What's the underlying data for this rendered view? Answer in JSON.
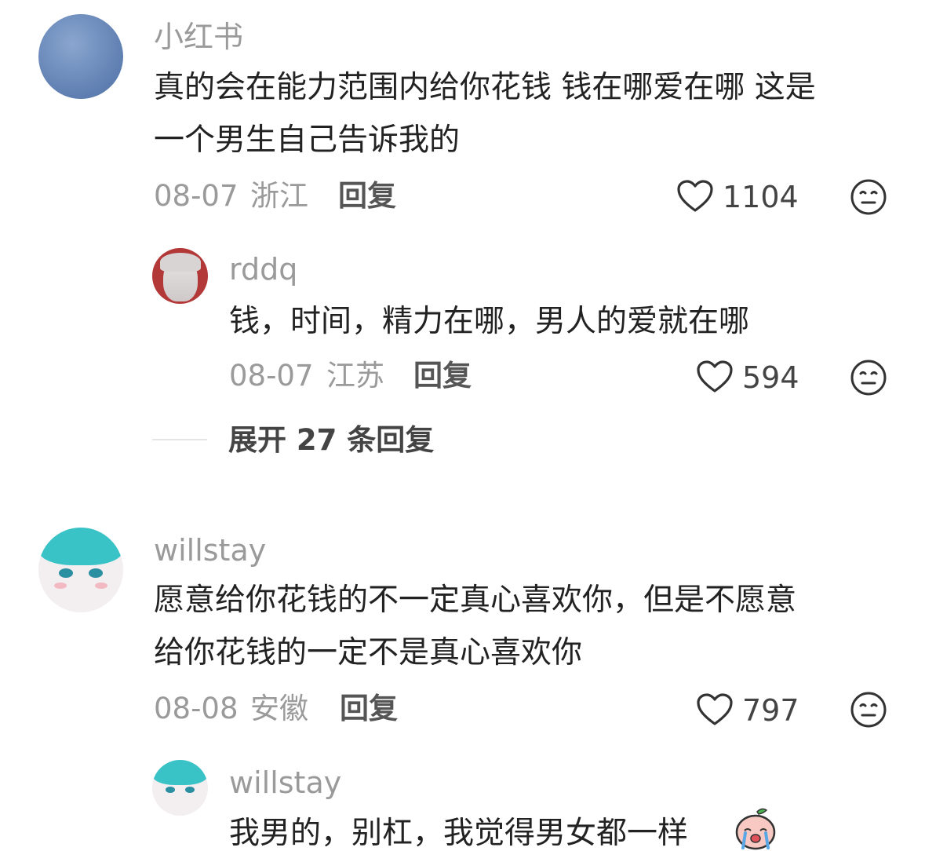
{
  "comments": [
    {
      "username": "小红书",
      "text_lines": [
        "真的会在能力范围内给你花钱 钱在哪爱在哪 这是",
        "一个男生自己告诉我的"
      ],
      "date": "08-07",
      "location": "浙江",
      "reply_label": "回复",
      "likes": "1104",
      "avatar_color": "#6f8fbf",
      "replies": [
        {
          "username": "rddq",
          "text_lines": [
            "钱，时间，精力在哪，男人的爱就在哪"
          ],
          "date": "08-07",
          "location": "江苏",
          "reply_label": "回复",
          "likes": "594",
          "avatar_color": "#b23a3a"
        }
      ],
      "expand_label": "展开 27 条回复"
    },
    {
      "username": "willstay",
      "text_lines": [
        "愿意给你花钱的不一定真心喜欢你，但是不愿意",
        "给你花钱的一定不是真心喜欢你"
      ],
      "date": "08-08",
      "location": "安徽",
      "reply_label": "回复",
      "likes": "797",
      "avatar_color": "#3cc6c6",
      "replies": [
        {
          "username": "willstay",
          "text_lines": [
            "我男的，别杠，我觉得男女都一样"
          ],
          "emoji": "crying-peach-sticker",
          "avatar_color": "#3cc6c6"
        }
      ]
    }
  ],
  "icons": {
    "like": "heart-outline-icon",
    "dislike": "meh-face-icon"
  },
  "colors": {
    "meta_gray": "#9a9a9a",
    "text": "#222222"
  }
}
